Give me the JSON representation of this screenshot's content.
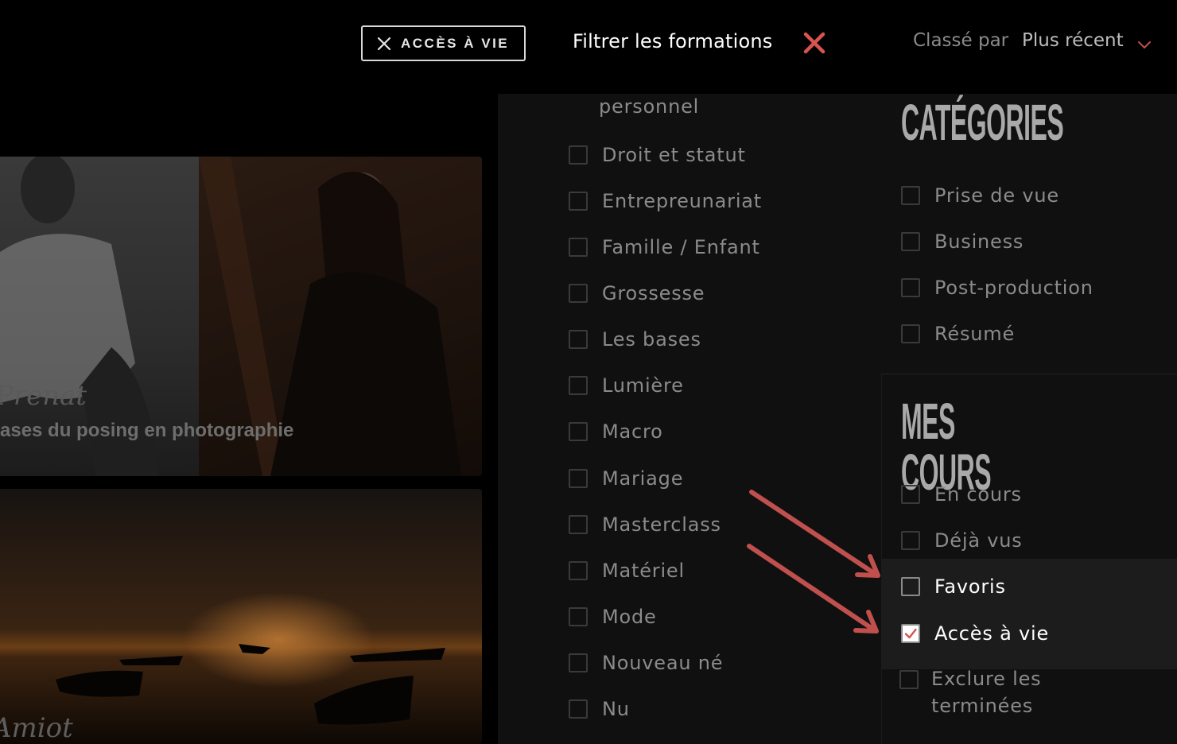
{
  "header": {
    "active_filter_chip": "ACCÈS À VIE",
    "filter_title": "Filtrer les formations",
    "sort_label": "Classé par",
    "sort_value": "Plus récent"
  },
  "courses": [
    {
      "author": "Prenat",
      "title": "ases du posing en photographie"
    },
    {
      "author": "Amiot"
    }
  ],
  "filters": {
    "partial_top": "personnel",
    "themes": [
      "Droit et statut",
      "Entrepreunariat",
      "Famille / Enfant",
      "Grossesse",
      "Les bases",
      "Lumière",
      "Macro",
      "Mariage",
      "Masterclass",
      "Matériel",
      "Mode",
      "Nouveau né",
      "Nu"
    ],
    "categories_heading": "CATÉGORIES",
    "categories": [
      "Prise de vue",
      "Business",
      "Post-production",
      "Résumé"
    ],
    "my_courses_heading": "MES COURS",
    "my_courses": [
      {
        "label": "En cours",
        "checked": false
      },
      {
        "label": "Déjà vus",
        "checked": false
      },
      {
        "label": "Favoris",
        "checked": false
      },
      {
        "label": "Accès à vie",
        "checked": true
      },
      {
        "label": "Exclure les",
        "label_line2": "terminées",
        "checked": false
      }
    ]
  },
  "colors": {
    "accent": "#d9534f",
    "annotation_arrow": "#c0504d"
  },
  "icons": [
    "close-icon",
    "close-filters-icon",
    "chevron-down-icon",
    "checkmark-icon",
    "annotation-arrow-icon"
  ]
}
